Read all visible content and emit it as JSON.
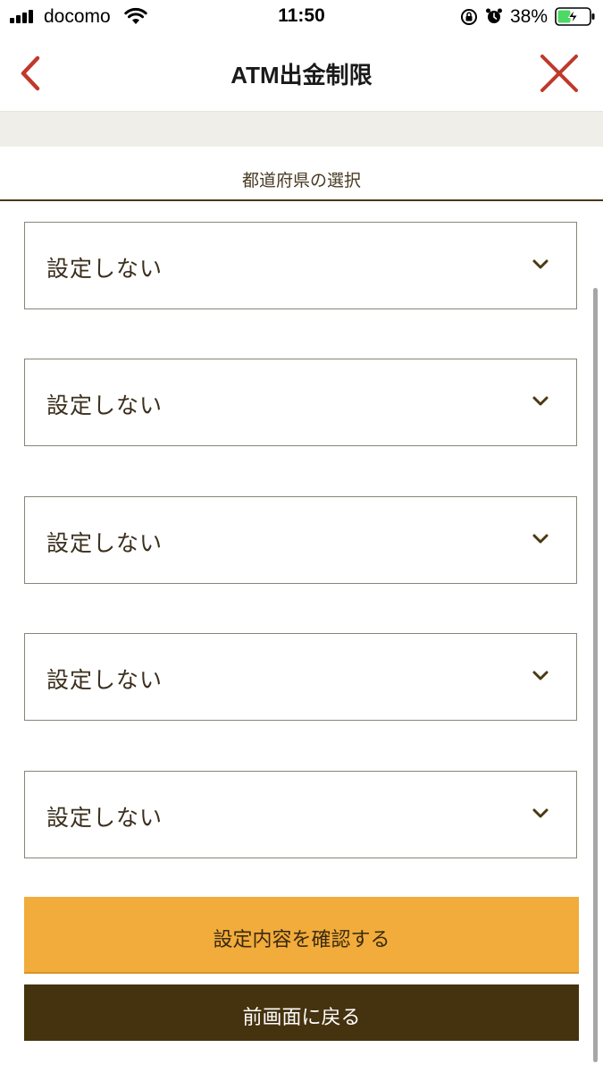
{
  "status_bar": {
    "carrier": "docomo",
    "time": "11:50",
    "battery_percent": "38%",
    "icons": [
      "signal-icon",
      "wifi-icon",
      "lock-rotation-icon",
      "alarm-icon",
      "battery-charging-icon"
    ]
  },
  "nav": {
    "title": "ATM出金制限",
    "back_icon": "chevron-left-icon",
    "close_icon": "close-icon",
    "accent_color": "#c0392b"
  },
  "section": {
    "heading": "都道府県の選択"
  },
  "selects": [
    {
      "value": "設定しない"
    },
    {
      "value": "設定しない"
    },
    {
      "value": "設定しない"
    },
    {
      "value": "設定しない"
    },
    {
      "value": "設定しない"
    }
  ],
  "buttons": {
    "confirm_label": "設定内容を確認する",
    "confirm_color": "#f2ac3b",
    "back_label": "前画面に戻る",
    "back_color": "#45320f"
  }
}
